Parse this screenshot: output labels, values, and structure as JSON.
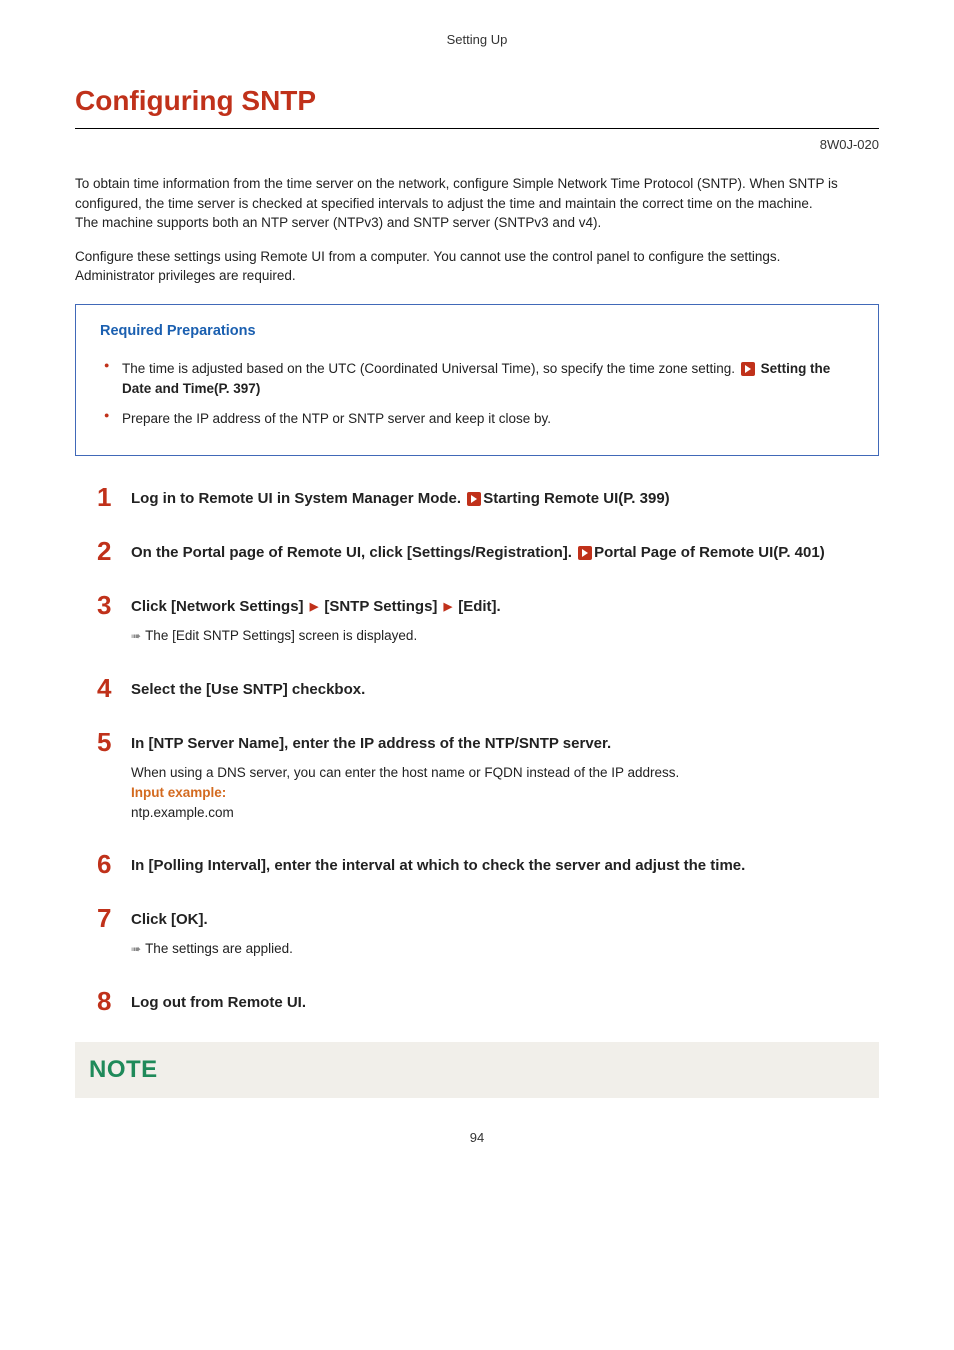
{
  "sectionHeader": "Setting Up",
  "title": "Configuring SNTP",
  "docCode": "8W0J-020",
  "intro1": "To obtain time information from the time server on the network, configure Simple Network Time Protocol (SNTP). When SNTP is configured, the time server is checked at specified intervals to adjust the time and maintain the correct time on the machine.",
  "intro2": "The machine supports both an NTP server (NTPv3) and SNTP server (SNTPv3 and v4).",
  "intro3": "Configure these settings using Remote UI from a computer. You cannot use the control panel to configure the settings.",
  "intro4": "Administrator privileges are required.",
  "prep": {
    "title": "Required Preparations",
    "item1a": "The time is adjusted based on the UTC (Coordinated Universal Time), so specify the time zone setting. ",
    "item1b": "Setting the Date and Time(P. 397)",
    "item2": "Prepare the IP address of the NTP or SNTP server and keep it close by."
  },
  "steps": {
    "s1": {
      "num": "1",
      "textA": "Log in to Remote UI in System Manager Mode. ",
      "link": "Starting Remote UI(P. 399)"
    },
    "s2": {
      "num": "2",
      "textA": "On the Portal page of Remote UI, click [Settings/Registration]. ",
      "link": "Portal Page of Remote UI(P. 401)"
    },
    "s3": {
      "num": "3",
      "textA": "Click [Network Settings] ",
      "b": "[SNTP Settings] ",
      "c": "[Edit].",
      "result": "The [Edit SNTP Settings] screen is displayed."
    },
    "s4": {
      "num": "4",
      "text": "Select the [Use SNTP] checkbox."
    },
    "s5": {
      "num": "5",
      "text": "In [NTP Server Name], enter the IP address of the NTP/SNTP server.",
      "sub1": "When using a DNS server, you can enter the host name or FQDN instead of the IP address.",
      "exLabel": "Input example:",
      "exVal": "ntp.example.com"
    },
    "s6": {
      "num": "6",
      "text": "In [Polling Interval], enter the interval at which to check the server and adjust the time."
    },
    "s7": {
      "num": "7",
      "text": "Click [OK].",
      "result": "The settings are applied."
    },
    "s8": {
      "num": "8",
      "text": "Log out from Remote UI."
    }
  },
  "noteTitle": "NOTE",
  "pageNum": "94"
}
